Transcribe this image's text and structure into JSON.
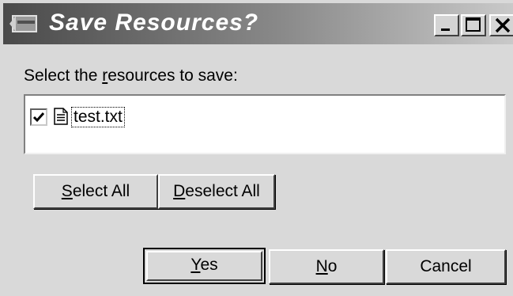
{
  "window": {
    "title": "Save Resources?",
    "controls": {
      "minimize": "minimize",
      "maximize": "maximize",
      "close": "close"
    }
  },
  "prompt": {
    "before": "Select the ",
    "mnemonic": "r",
    "after": "esources to save:"
  },
  "resources": [
    {
      "name": "test.txt",
      "checked": true,
      "icon": "text-file-icon"
    }
  ],
  "buttons": {
    "select_all": {
      "mnemonic": "S",
      "rest": "elect All"
    },
    "deselect_all": {
      "mnemonic": "D",
      "rest": "eselect All"
    },
    "yes": {
      "mnemonic": "Y",
      "rest": "es"
    },
    "no": {
      "mnemonic": "N",
      "rest": "o"
    },
    "cancel": {
      "label": "Cancel"
    }
  },
  "colors": {
    "dialog_bg": "#d9d9d9",
    "titlebar_start": "#4a4a4a",
    "titlebar_end": "#c9c9c9",
    "title_text": "#ffffff"
  }
}
